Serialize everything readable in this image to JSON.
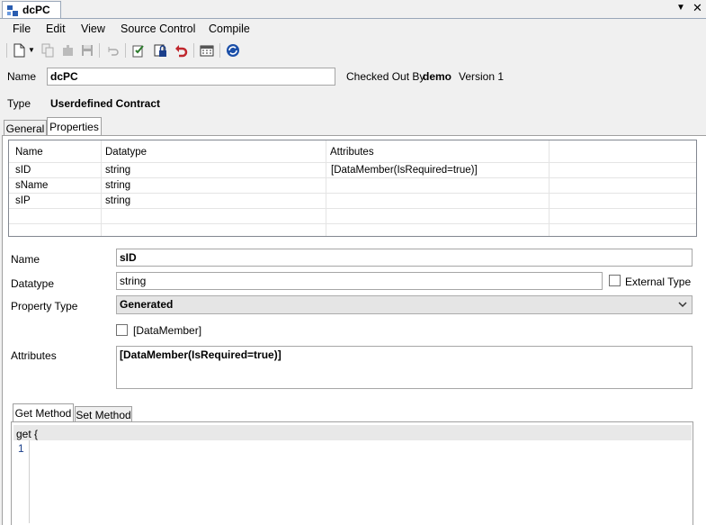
{
  "document_tab": {
    "title": "dcPC"
  },
  "window_controls": {
    "dropdown": "▼",
    "close": "✕"
  },
  "menu": [
    "File",
    "Edit",
    "View",
    "Source Control",
    "Compile"
  ],
  "header": {
    "name_label": "Name",
    "name_value": "dcPC",
    "checked_out_label": "Checked Out By",
    "checked_out_user": "demo",
    "version": "Version 1",
    "type_label": "Type",
    "type_value": "Userdefined Contract"
  },
  "tabs": {
    "general": "General",
    "properties": "Properties"
  },
  "grid": {
    "columns": [
      "Name",
      "Datatype",
      "Attributes"
    ],
    "rows": [
      {
        "name": "sID",
        "datatype": "string",
        "attributes": "[DataMember(IsRequired=true)]"
      },
      {
        "name": "sName",
        "datatype": "string",
        "attributes": ""
      },
      {
        "name": "sIP",
        "datatype": "string",
        "attributes": ""
      }
    ]
  },
  "details": {
    "name_label": "Name",
    "name_value": "sID",
    "datatype_label": "Datatype",
    "datatype_value": "string",
    "external_type_label": "External Type",
    "property_type_label": "Property Type",
    "property_type_value": "Generated",
    "datamember_label": "[DataMember]",
    "attributes_label": "Attributes",
    "attributes_value": "[DataMember(IsRequired=true)]"
  },
  "method_tabs": {
    "get": "Get Method",
    "set": "Set Method"
  },
  "code": {
    "line1": "get {",
    "line_number": "1"
  }
}
